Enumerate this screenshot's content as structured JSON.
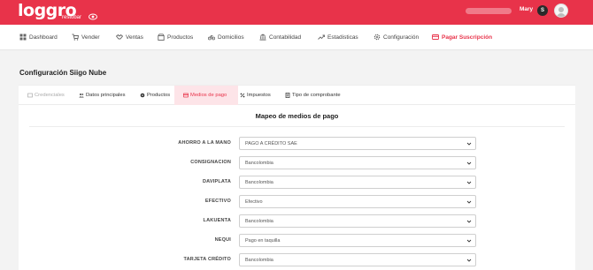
{
  "brand": {
    "logo_text": "loggro",
    "logo_sub": "restobar",
    "accent": "#e8334a"
  },
  "user": {
    "name": "Mary",
    "badge": "S"
  },
  "nav": {
    "items": [
      {
        "label": "Dashboard",
        "icon": "dashboard-icon"
      },
      {
        "label": "Vender",
        "icon": "cart-icon"
      },
      {
        "label": "Ventas",
        "icon": "handshake-icon"
      },
      {
        "label": "Productos",
        "icon": "box-icon"
      },
      {
        "label": "Domicilios",
        "icon": "bike-icon"
      },
      {
        "label": "Contabilidad",
        "icon": "bank-icon"
      },
      {
        "label": "Estadisticas",
        "icon": "trend-icon"
      },
      {
        "label": "Configuración",
        "icon": "gear-icon"
      },
      {
        "label": "Pagar Suscripción",
        "icon": "card-icon"
      }
    ]
  },
  "page": {
    "title": "Configuración Siigo Nube"
  },
  "tabs": [
    {
      "label": "Credenciales",
      "icon": "key-icon",
      "state": "disabled"
    },
    {
      "label": "Datos principales",
      "icon": "users-icon",
      "state": "normal"
    },
    {
      "label": "Productos",
      "icon": "gear-icon",
      "state": "normal"
    },
    {
      "label": "Medios de pago",
      "icon": "card-icon",
      "state": "active"
    },
    {
      "label": "Impuestos",
      "icon": "percent-icon",
      "state": "normal"
    },
    {
      "label": "Tipo de comprobante",
      "icon": "document-icon",
      "state": "normal"
    }
  ],
  "section": {
    "title": "Mapeo de medios de pago"
  },
  "mappings": [
    {
      "label": "AHORRO A LA MANO",
      "value": "PAGO A CRÉDITO SAE"
    },
    {
      "label": "CONSIGNACION",
      "value": "Bancolombia"
    },
    {
      "label": "DAVIPLATA",
      "value": "Bancolombia"
    },
    {
      "label": "EFECTIVO",
      "value": "Efectivo"
    },
    {
      "label": "LAKUENTA",
      "value": "Bancolombia"
    },
    {
      "label": "NEQUI",
      "value": "Pago en taquilla"
    },
    {
      "label": "TARJETA CRÉDITO",
      "value": "Bancolombia"
    }
  ]
}
